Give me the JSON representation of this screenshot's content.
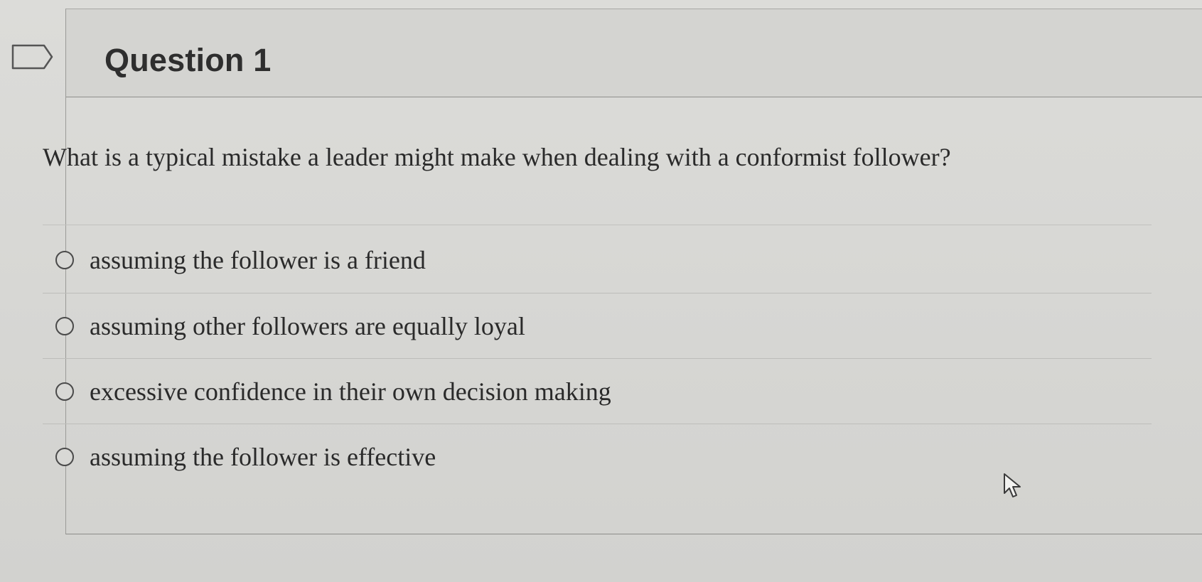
{
  "question": {
    "title": "Question 1",
    "text": "What is a typical mistake a leader might make when dealing with a conformist follower?",
    "options": [
      {
        "label": "assuming the follower is a friend",
        "selected": false
      },
      {
        "label": "assuming other followers are equally loyal",
        "selected": false
      },
      {
        "label": "excessive confidence in their own decision making",
        "selected": false
      },
      {
        "label": "assuming the follower is effective",
        "selected": false
      }
    ]
  },
  "icons": {
    "flag": "flag-icon",
    "radio": "radio-unchecked-icon",
    "cursor": "mouse-pointer-icon"
  },
  "colors": {
    "background": "#d9d9d6",
    "text": "#2a2a2a",
    "divider": "#8f8f8c"
  }
}
